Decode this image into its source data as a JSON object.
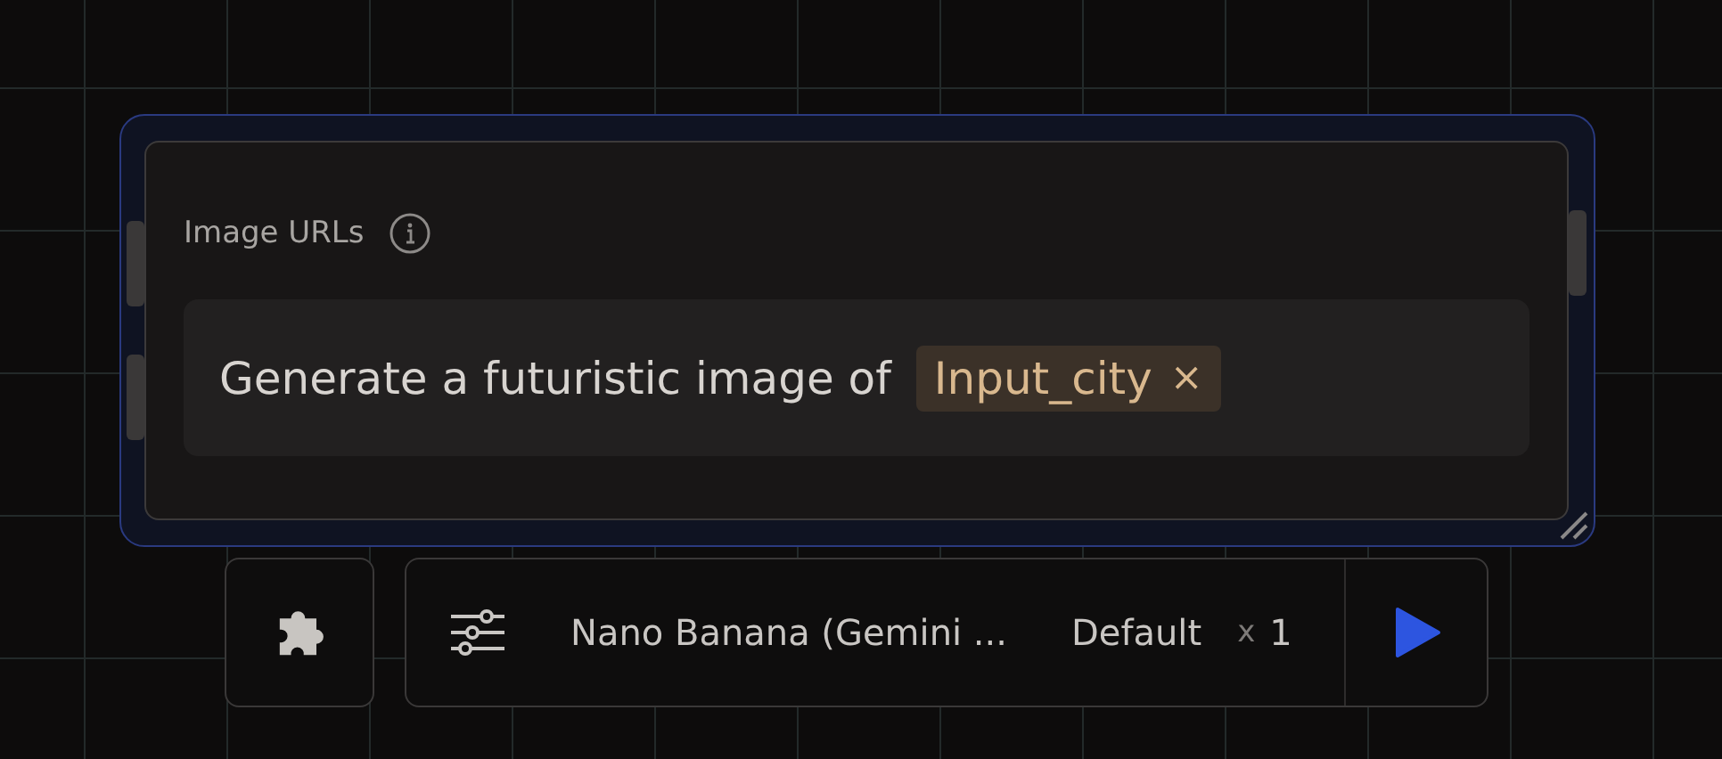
{
  "node": {
    "label": "Image URLs",
    "selected": true,
    "prompt": {
      "text": "Generate a futuristic image of",
      "chip": {
        "label": "Input_city",
        "remove": "×"
      }
    }
  },
  "toolbar": {
    "model": "Nano Banana (Gemini ...",
    "preset": "Default",
    "multiplier": "x",
    "count": "1"
  }
}
